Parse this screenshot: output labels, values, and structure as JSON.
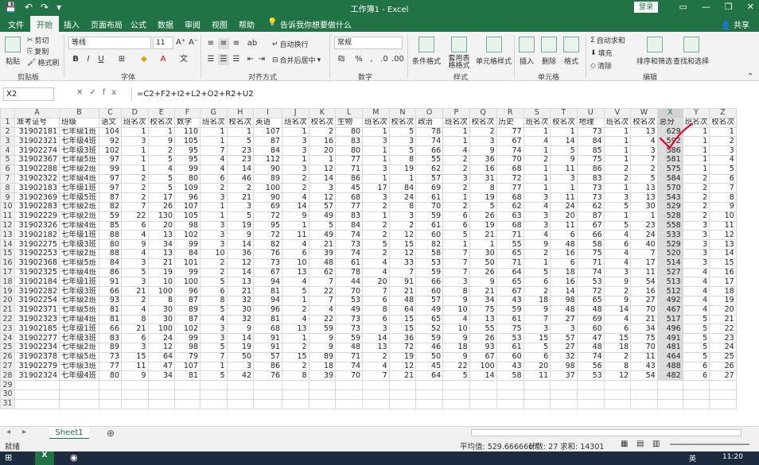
{
  "titlebar": {
    "title": "工作簿1 - Excel",
    "login": "登录"
  },
  "tabs": [
    "文件",
    "开始",
    "插入",
    "页面布局",
    "公式",
    "数据",
    "审阅",
    "视图",
    "帮助"
  ],
  "active_tab": "开始",
  "tell_me": "告诉我你想要做什么",
  "share": "共享",
  "ribbon": {
    "clipboard": {
      "paste": "粘贴",
      "cut": "剪切",
      "copy": "复制",
      "format_painter": "格式刷",
      "label": "剪贴板"
    },
    "font": {
      "name": "等线",
      "size": "11",
      "label": "字体"
    },
    "alignment": {
      "wrap": "自动换行",
      "merge": "合并后居中",
      "label": "对齐方式"
    },
    "number": {
      "format": "常规",
      "label": "数字"
    },
    "styles": {
      "cond": "条件格式",
      "table": "套用表格格式",
      "cell": "单元格样式",
      "label": "样式"
    },
    "cells": {
      "insert": "插入",
      "delete": "删除",
      "format": "格式",
      "label": "单元格"
    },
    "editing": {
      "autosum": "自动求和",
      "fill": "填充",
      "clear": "清除",
      "sort": "排序和筛选",
      "find": "查找和选择",
      "label": "编辑"
    }
  },
  "formula_bar": {
    "name_box": "X2",
    "formula": "=C2+F2+I2+L2+O2+R2+U2"
  },
  "columns": [
    "A",
    "B",
    "C",
    "D",
    "E",
    "F",
    "G",
    "H",
    "I",
    "J",
    "K",
    "L",
    "M",
    "N",
    "O",
    "P",
    "Q",
    "R",
    "S",
    "T",
    "U",
    "V",
    "W",
    "X",
    "Y",
    "Z"
  ],
  "header_row": [
    "准考证号",
    "班级",
    "语文",
    "班名次",
    "校名次",
    "数学",
    "班名次",
    "校名次",
    "英语",
    "班名次",
    "校名次",
    "生物",
    "班名次",
    "校名次",
    "政治",
    "班名次",
    "校名次",
    "历史",
    "班名次",
    "校名次",
    "地理",
    "班名次",
    "校名次",
    "总分",
    "班名次",
    "校名次"
  ],
  "rows": [
    [
      "31902181",
      "七年级1班",
      "104",
      "1",
      "1",
      "110",
      "1",
      "1",
      "107",
      "1",
      "2",
      "80",
      "1",
      "5",
      "78",
      "1",
      "2",
      "77",
      "1",
      "1",
      "73",
      "1",
      "13",
      "629",
      "1",
      "1"
    ],
    [
      "31902321",
      "七年级4班",
      "92",
      "3",
      "9",
      "105",
      "1",
      "5",
      "87",
      "3",
      "16",
      "83",
      "3",
      "3",
      "74",
      "1",
      "3",
      "67",
      "4",
      "14",
      "84",
      "1",
      "4",
      "592",
      "1",
      "2"
    ],
    [
      "31902274",
      "七年级3班",
      "102",
      "1",
      "2",
      "95",
      "7",
      "23",
      "84",
      "3",
      "20",
      "80",
      "1",
      "5",
      "66",
      "4",
      "9",
      "74",
      "1",
      "5",
      "85",
      "1",
      "3",
      "586",
      "1",
      "3"
    ],
    [
      "31902367",
      "七年级5班",
      "97",
      "1",
      "5",
      "95",
      "4",
      "23",
      "112",
      "1",
      "1",
      "77",
      "1",
      "8",
      "55",
      "2",
      "36",
      "70",
      "2",
      "9",
      "75",
      "1",
      "7",
      "581",
      "1",
      "4"
    ],
    [
      "31902288",
      "七年级2班",
      "99",
      "1",
      "4",
      "99",
      "4",
      "14",
      "90",
      "3",
      "12",
      "71",
      "3",
      "19",
      "62",
      "2",
      "16",
      "68",
      "1",
      "11",
      "86",
      "2",
      "2",
      "575",
      "1",
      "5"
    ],
    [
      "31902322",
      "七年级4班",
      "97",
      "2",
      "5",
      "80",
      "6",
      "46",
      "89",
      "2",
      "14",
      "86",
      "1",
      "1",
      "57",
      "3",
      "31",
      "72",
      "1",
      "3",
      "83",
      "2",
      "5",
      "584",
      "2",
      "6"
    ],
    [
      "31902183",
      "七年级1班",
      "97",
      "2",
      "5",
      "109",
      "2",
      "2",
      "100",
      "2",
      "3",
      "45",
      "17",
      "84",
      "69",
      "2",
      "8",
      "77",
      "1",
      "1",
      "73",
      "1",
      "13",
      "570",
      "2",
      "7"
    ],
    [
      "31902369",
      "七年级5班",
      "87",
      "2",
      "17",
      "96",
      "3",
      "21",
      "90",
      "4",
      "12",
      "68",
      "3",
      "24",
      "61",
      "1",
      "19",
      "68",
      "3",
      "11",
      "73",
      "3",
      "13",
      "543",
      "2",
      "8"
    ],
    [
      "31902283",
      "七年级2班",
      "82",
      "7",
      "26",
      "107",
      "1",
      "3",
      "69",
      "14",
      "57",
      "77",
      "2",
      "8",
      "70",
      "2",
      "5",
      "62",
      "4",
      "24",
      "62",
      "5",
      "30",
      "529",
      "2",
      "9"
    ],
    [
      "31902229",
      "七年级2班",
      "59",
      "22",
      "130",
      "105",
      "1",
      "5",
      "72",
      "9",
      "49",
      "83",
      "1",
      "3",
      "59",
      "6",
      "26",
      "63",
      "3",
      "20",
      "87",
      "1",
      "1",
      "528",
      "2",
      "10"
    ],
    [
      "31902326",
      "七年级4班",
      "85",
      "6",
      "20",
      "98",
      "3",
      "19",
      "95",
      "1",
      "5",
      "84",
      "2",
      "2",
      "61",
      "6",
      "19",
      "68",
      "3",
      "11",
      "67",
      "5",
      "23",
      "558",
      "3",
      "11"
    ],
    [
      "31902182",
      "七年级1班",
      "88",
      "4",
      "13",
      "102",
      "3",
      "9",
      "72",
      "11",
      "49",
      "74",
      "2",
      "12",
      "60",
      "5",
      "21",
      "71",
      "4",
      "6",
      "66",
      "4",
      "24",
      "533",
      "3",
      "12"
    ],
    [
      "31902275",
      "七年级3班",
      "80",
      "9",
      "34",
      "99",
      "3",
      "14",
      "82",
      "4",
      "21",
      "73",
      "5",
      "15",
      "82",
      "1",
      "1",
      "55",
      "9",
      "48",
      "58",
      "6",
      "40",
      "529",
      "3",
      "13"
    ],
    [
      "31902253",
      "七年级2班",
      "88",
      "4",
      "13",
      "84",
      "10",
      "36",
      "76",
      "6",
      "39",
      "74",
      "2",
      "12",
      "58",
      "7",
      "30",
      "65",
      "2",
      "16",
      "75",
      "4",
      "7",
      "520",
      "3",
      "14"
    ],
    [
      "31902368",
      "七年级5班",
      "84",
      "3",
      "21",
      "101",
      "2",
      "12",
      "73",
      "10",
      "48",
      "61",
      "4",
      "33",
      "53",
      "7",
      "50",
      "71",
      "1",
      "6",
      "71",
      "4",
      "17",
      "514",
      "3",
      "15"
    ],
    [
      "31902325",
      "七年级4班",
      "86",
      "5",
      "19",
      "99",
      "2",
      "14",
      "67",
      "13",
      "62",
      "78",
      "4",
      "7",
      "59",
      "7",
      "26",
      "64",
      "5",
      "18",
      "74",
      "3",
      "11",
      "527",
      "4",
      "16"
    ],
    [
      "31902184",
      "七年级1班",
      "91",
      "3",
      "10",
      "100",
      "5",
      "13",
      "94",
      "4",
      "7",
      "44",
      "20",
      "91",
      "66",
      "3",
      "9",
      "65",
      "6",
      "16",
      "53",
      "9",
      "54",
      "513",
      "4",
      "17"
    ],
    [
      "31902282",
      "七年级3班",
      "66",
      "21",
      "100",
      "96",
      "6",
      "21",
      "81",
      "5",
      "22",
      "70",
      "7",
      "21",
      "60",
      "8",
      "21",
      "67",
      "2",
      "14",
      "72",
      "2",
      "16",
      "512",
      "4",
      "18"
    ],
    [
      "31902254",
      "七年级2班",
      "93",
      "2",
      "8",
      "87",
      "8",
      "32",
      "94",
      "1",
      "7",
      "53",
      "6",
      "48",
      "57",
      "9",
      "34",
      "43",
      "18",
      "98",
      "65",
      "9",
      "27",
      "492",
      "4",
      "19"
    ],
    [
      "31902371",
      "七年级5班",
      "81",
      "4",
      "30",
      "89",
      "5",
      "30",
      "96",
      "2",
      "4",
      "49",
      "8",
      "64",
      "49",
      "10",
      "75",
      "59",
      "9",
      "48",
      "48",
      "14",
      "70",
      "467",
      "4",
      "20"
    ],
    [
      "31902323",
      "七年级4班",
      "81",
      "8",
      "30",
      "87",
      "4",
      "32",
      "81",
      "4",
      "22",
      "73",
      "6",
      "15",
      "65",
      "4",
      "13",
      "61",
      "7",
      "27",
      "69",
      "4",
      "21",
      "517",
      "5",
      "21"
    ],
    [
      "31902185",
      "七年级1班",
      "66",
      "21",
      "100",
      "102",
      "3",
      "9",
      "68",
      "13",
      "59",
      "73",
      "3",
      "15",
      "52",
      "10",
      "55",
      "75",
      "3",
      "3",
      "60",
      "6",
      "34",
      "496",
      "5",
      "22"
    ],
    [
      "31902277",
      "七年级3班",
      "83",
      "6",
      "24",
      "99",
      "3",
      "14",
      "91",
      "1",
      "9",
      "59",
      "14",
      "36",
      "59",
      "9",
      "26",
      "53",
      "15",
      "57",
      "47",
      "15",
      "75",
      "491",
      "5",
      "23"
    ],
    [
      "31902234",
      "七年级2班",
      "89",
      "3",
      "12",
      "98",
      "5",
      "19",
      "91",
      "2",
      "9",
      "48",
      "13",
      "72",
      "46",
      "18",
      "93",
      "61",
      "5",
      "27",
      "48",
      "18",
      "70",
      "481",
      "5",
      "24"
    ],
    [
      "31902378",
      "七年级5班",
      "73",
      "15",
      "64",
      "79",
      "7",
      "50",
      "57",
      "15",
      "89",
      "71",
      "2",
      "19",
      "50",
      "9",
      "67",
      "60",
      "6",
      "32",
      "74",
      "2",
      "11",
      "464",
      "5",
      "25"
    ],
    [
      "31902279",
      "七年级3班",
      "77",
      "11",
      "47",
      "107",
      "1",
      "3",
      "86",
      "2",
      "18",
      "74",
      "4",
      "12",
      "45",
      "22",
      "100",
      "43",
      "20",
      "98",
      "56",
      "8",
      "43",
      "488",
      "6",
      "26"
    ],
    [
      "31902324",
      "七年级4班",
      "80",
      "9",
      "34",
      "81",
      "5",
      "42",
      "76",
      "8",
      "39",
      "70",
      "7",
      "21",
      "64",
      "5",
      "14",
      "58",
      "11",
      "37",
      "53",
      "12",
      "54",
      "482",
      "6",
      "27"
    ]
  ],
  "sheet_tab": "Sheet1",
  "status": {
    "ready": "就绪",
    "average": "平均值: 529.6666667",
    "count": "计数: 27",
    "sum": "求和: 14301"
  },
  "taskbar": {
    "clock": "11:20",
    "ime": "英"
  }
}
